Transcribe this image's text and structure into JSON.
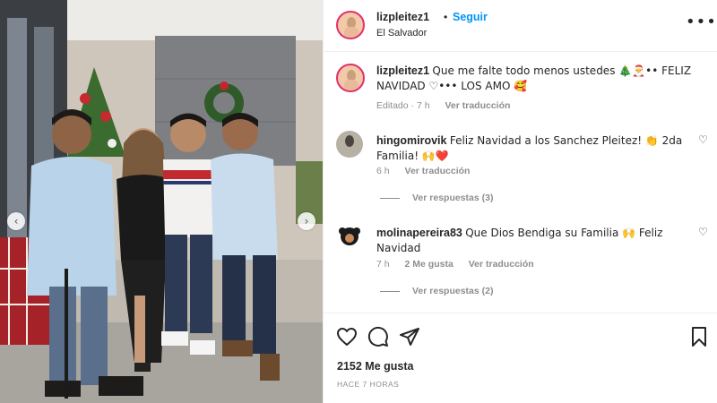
{
  "post": {
    "username": "lizpleitez1",
    "dot": "•",
    "follow_label": "Seguir",
    "location": "El Salvador",
    "more_icon": "more-options-icon",
    "caption": {
      "username": "lizpleitez1",
      "text": "Que me falte todo menos ustedes 🎄🎅•• FELIZ NAVIDAD ♡••• LOS AMO 🥰",
      "edited": "Editado · 7 h",
      "see_translation": "Ver traducción"
    }
  },
  "comments": [
    {
      "username": "hingomirovik",
      "text": "Feliz Navidad a los Sanchez Pleitez! 👏 2da Familia! 🙌❤️",
      "time": "6 h",
      "see_translation": "Ver traducción",
      "replies": "Ver respuestas (3)"
    },
    {
      "username": "molinapereira83",
      "text": "Que Dios Bendiga su Familia 🙌 Feliz Navidad",
      "time": "7 h",
      "likes": "2 Me gusta",
      "see_translation": "Ver traducción",
      "replies": "Ver respuestas (2)"
    }
  ],
  "footer": {
    "likes": "2152 Me gusta",
    "time_ago": "HACE 7 HORAS"
  },
  "icons": [
    "heart-icon",
    "comment-icon",
    "share-icon",
    "save-icon",
    "chevron-left-icon",
    "chevron-right-icon"
  ],
  "colors": {
    "accent": "#0095f6",
    "text": "#262626",
    "muted": "#8e8e8e",
    "border": "#efefef"
  }
}
